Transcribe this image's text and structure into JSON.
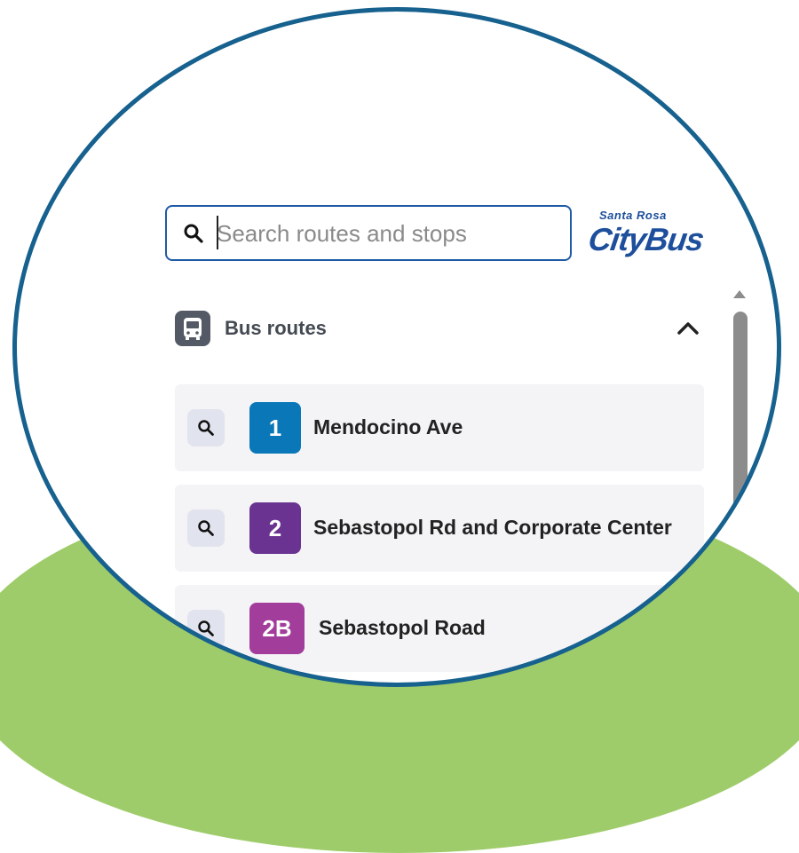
{
  "search": {
    "placeholder": "Search routes and stops"
  },
  "logo": {
    "top": "Santa Rosa",
    "main": "CityBus",
    "color": "#1e4f9c"
  },
  "section": {
    "title": "Bus routes"
  },
  "routes": [
    {
      "number": "1",
      "name": "Mendocino Ave",
      "color": "#0a77b8"
    },
    {
      "number": "2",
      "name": "Sebastopol Rd and Corporate Center",
      "color": "#6a3391"
    },
    {
      "number": "2B",
      "name": "Sebastopol Road",
      "color": "#a23d9b"
    }
  ],
  "colors": {
    "frame": "#17618f",
    "accent_border": "#1f5aa6",
    "green": "#9fcc6a"
  }
}
